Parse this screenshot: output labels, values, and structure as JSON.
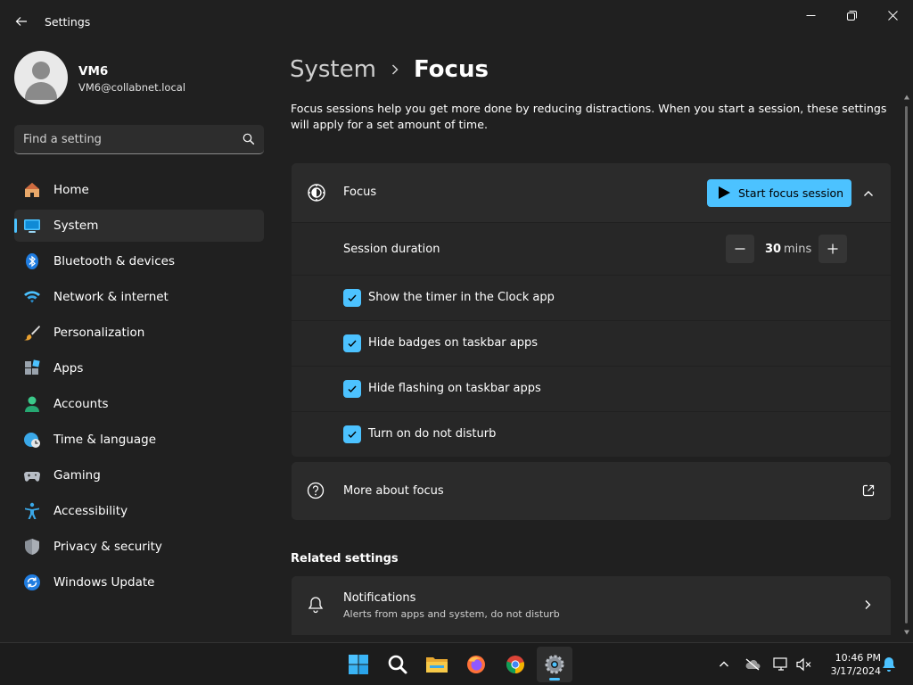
{
  "window": {
    "title": "Settings"
  },
  "profile": {
    "name": "VM6",
    "email": "VM6@collabnet.local"
  },
  "search": {
    "placeholder": "Find a setting"
  },
  "sidebar": {
    "items": [
      {
        "label": "Home",
        "icon": "home-icon"
      },
      {
        "label": "System",
        "icon": "system-icon",
        "active": true
      },
      {
        "label": "Bluetooth & devices",
        "icon": "bluetooth-icon"
      },
      {
        "label": "Network & internet",
        "icon": "wifi-icon"
      },
      {
        "label": "Personalization",
        "icon": "brush-icon"
      },
      {
        "label": "Apps",
        "icon": "apps-icon"
      },
      {
        "label": "Accounts",
        "icon": "accounts-icon"
      },
      {
        "label": "Time & language",
        "icon": "globe-clock-icon"
      },
      {
        "label": "Gaming",
        "icon": "gamepad-icon"
      },
      {
        "label": "Accessibility",
        "icon": "accessibility-icon"
      },
      {
        "label": "Privacy & security",
        "icon": "shield-icon"
      },
      {
        "label": "Windows Update",
        "icon": "update-icon"
      }
    ]
  },
  "breadcrumb": {
    "parent": "System",
    "current": "Focus"
  },
  "description": "Focus sessions help you get more done by reducing distractions. When you start a session, these settings will apply for a set amount of time.",
  "focus": {
    "label": "Focus",
    "start_button": "Start focus session",
    "duration_label": "Session duration",
    "duration_value": "30",
    "duration_unit": "mins",
    "options": [
      {
        "label": "Show the timer in the Clock app",
        "checked": true
      },
      {
        "label": "Hide badges on taskbar apps",
        "checked": true
      },
      {
        "label": "Hide flashing on taskbar apps",
        "checked": true
      },
      {
        "label": "Turn on do not disturb",
        "checked": true
      }
    ]
  },
  "more_about": {
    "label": "More about focus"
  },
  "related": {
    "heading": "Related settings",
    "notifications": {
      "label": "Notifications",
      "sub": "Alerts from apps and system, do not disturb"
    }
  },
  "taskbar": {
    "apps": [
      "start-icon",
      "search-icon",
      "file-explorer-icon",
      "firefox-icon",
      "chrome-icon",
      "settings-icon"
    ],
    "clock_time": "10:46 PM",
    "clock_date": "3/17/2024"
  },
  "colors": {
    "accent": "#4cc2ff",
    "background": "#202020",
    "card": "#2b2b2b"
  }
}
